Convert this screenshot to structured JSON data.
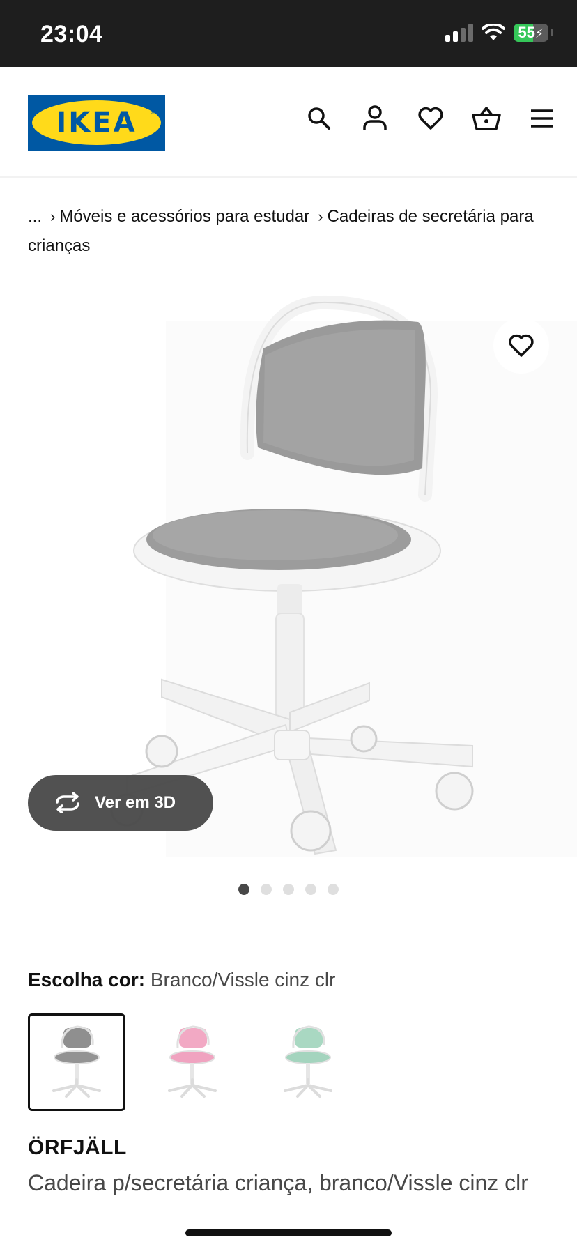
{
  "status_bar": {
    "time": "23:04",
    "battery_level": "55",
    "battery_fraction": 0.55,
    "icons": [
      "cellular-signal-icon",
      "wifi-icon",
      "battery-charging-icon"
    ]
  },
  "header": {
    "logo_text": "IKEA",
    "brand_colors": {
      "blue": "#0058a3",
      "yellow": "#ffda1a"
    },
    "icons": [
      "search-icon",
      "account-icon",
      "wishlist-heart-icon",
      "shopping-basket-icon",
      "menu-hamburger-icon"
    ]
  },
  "breadcrumb": {
    "ellipsis": "...",
    "items": [
      "Móveis e acessórios para estudar",
      "Cadeiras de secretária para crianças"
    ]
  },
  "gallery": {
    "view_3d_label": "Ver em 3D",
    "slide_count": 5,
    "active_slide": 1
  },
  "color": {
    "label": "Escolha cor:",
    "value": "Branco/Vissle cinz clr",
    "options": [
      {
        "name": "grey",
        "seat_color": "#8f8f8f",
        "selected": true
      },
      {
        "name": "pink",
        "seat_color": "#f2a9c4",
        "selected": false
      },
      {
        "name": "mint",
        "seat_color": "#a9d8c2",
        "selected": false
      }
    ]
  },
  "product": {
    "name": "ÖRFJÄLL",
    "description": "Cadeira p/secretária criança, branco/Vissle cinz clr"
  }
}
